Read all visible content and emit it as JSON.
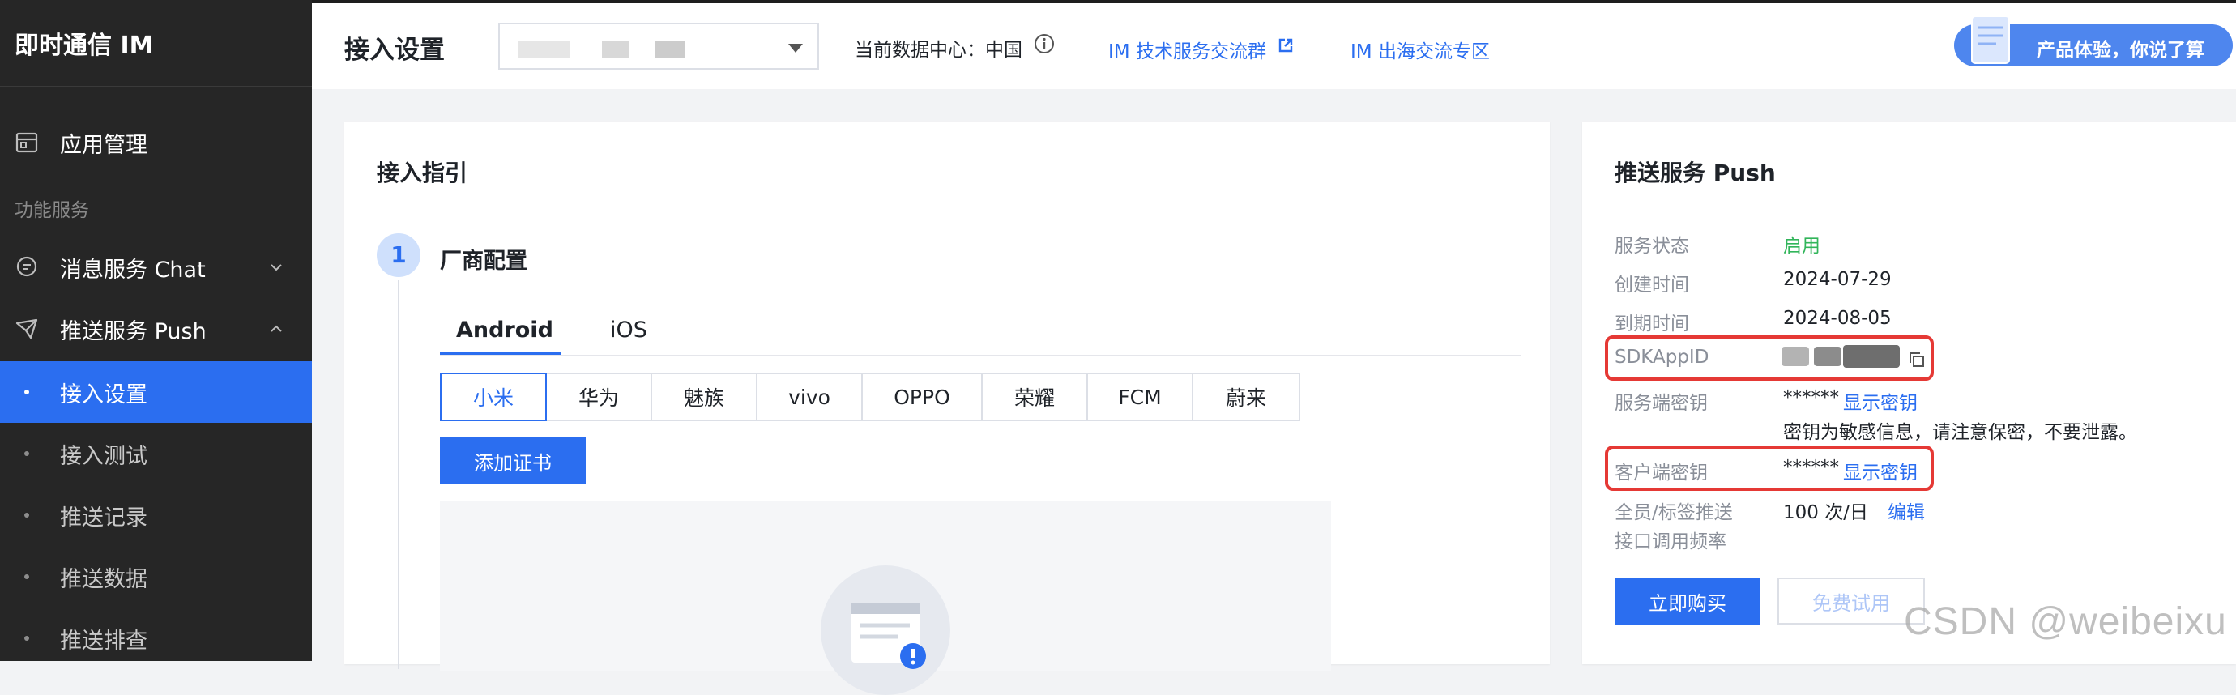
{
  "sidebar": {
    "brand": "即时通信 IM",
    "app_management": "应用管理",
    "section_label": "功能服务",
    "chat": "消息服务 Chat",
    "push": "推送服务 Push",
    "sub_items": [
      {
        "label": "接入设置",
        "active": true
      },
      {
        "label": "接入测试",
        "active": false
      },
      {
        "label": "推送记录",
        "active": false
      },
      {
        "label": "推送数据",
        "active": false
      },
      {
        "label": "推送排查",
        "active": false
      }
    ]
  },
  "header": {
    "title": "接入设置",
    "data_center": "当前数据中心：中国",
    "link_group": "IM 技术服务交流群",
    "link_overseas": "IM 出海交流专区",
    "feedback": "产品体验，你说了算"
  },
  "guide": {
    "title": "接入指引",
    "step_number": "1",
    "step_title": "厂商配置",
    "tabs": [
      "Android",
      "iOS"
    ],
    "active_tab": "Android",
    "vendors": [
      "小米",
      "华为",
      "魅族",
      "vivo",
      "OPPO",
      "荣耀",
      "FCM",
      "蔚来"
    ],
    "active_vendor": "小米",
    "add_cert": "添加证书"
  },
  "push": {
    "title": "推送服务 Push",
    "status_label": "服务状态",
    "status_value": "启用",
    "created_label": "创建时间",
    "created_value": "2024-07-29",
    "expire_label": "到期时间",
    "expire_value": "2024-08-05",
    "sdkappid_label": "SDKAppID",
    "server_key_label": "服务端密钥",
    "server_key_value": "******",
    "show_key": "显示密钥",
    "key_warning": "密钥为敏感信息，请注意保密，不要泄露。",
    "client_key_label": "客户端密钥",
    "client_key_value": "******",
    "rate_label_1": "全员/标签推送",
    "rate_label_2": "接口调用频率",
    "rate_value": "100 次/日",
    "edit": "编辑",
    "buy": "立即购买",
    "trial": "免费试用"
  },
  "watermark": "CSDN @weibeixu",
  "colors": {
    "accent": "#2b6ef0",
    "sidebar": "#262626",
    "highlight": "#e53935",
    "status_on": "#31b55a"
  }
}
